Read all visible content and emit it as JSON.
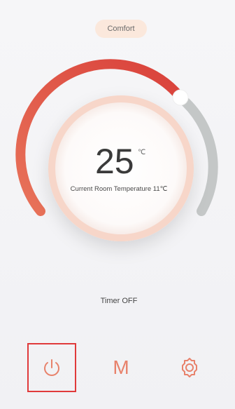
{
  "mode": {
    "label": "Comfort"
  },
  "thermostat": {
    "set_temperature": "25",
    "unit": "℃",
    "room_temperature_text": "Current Room Temperature 11℃"
  },
  "timer": {
    "status": "Timer OFF"
  },
  "controls": {
    "mode_letter": "M"
  },
  "colors": {
    "arc_start": "#e8735a",
    "arc_end": "#d9403a",
    "arc_inactive": "#c4c7c7",
    "icon": "#e8826b",
    "highlight_border": "#e03a3a"
  },
  "icons": [
    "power-icon",
    "settings-gear-icon"
  ]
}
